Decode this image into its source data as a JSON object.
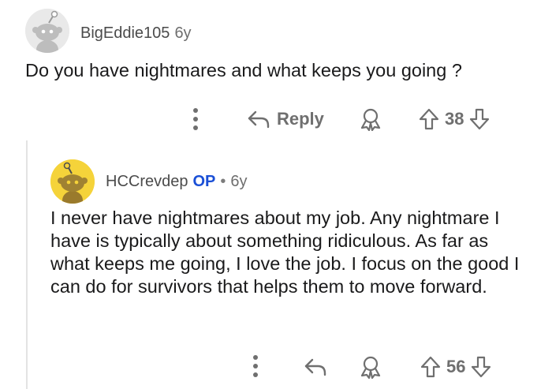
{
  "parent_comment": {
    "username": "BigEddie105",
    "age": "6y",
    "body": "Do you have nightmares and what keeps you going ?",
    "actions": {
      "more_icon": "vertical-ellipsis-icon",
      "reply_label": "Reply",
      "award_icon": "award-icon",
      "upvote_icon": "upvote-arrow-icon",
      "score": "38",
      "downvote_icon": "downvote-arrow-icon"
    }
  },
  "reply_comment": {
    "username": "HCCrevdep",
    "op_badge": "OP",
    "separator": "•",
    "age": "6y",
    "body": "I never have nightmares about my job. Any nightmare I have is typically about something ridiculous. As far as what keeps me going, I love the job. I focus on the good I can do for survivors that helps them to move forward.",
    "actions": {
      "more_icon": "vertical-ellipsis-icon",
      "reply_icon": "reply-arrow-icon",
      "award_icon": "award-icon",
      "upvote_icon": "upvote-arrow-icon",
      "score": "56",
      "downvote_icon": "downvote-arrow-icon"
    }
  },
  "colors": {
    "text": "#1a1a1b",
    "meta": "#6f6f6f",
    "op_badge": "#1a4fd6",
    "avatar_grey_bg": "#e9e9e9",
    "avatar_yellow_bg": "#f5d33a",
    "thread_line": "#e3e3e3"
  }
}
